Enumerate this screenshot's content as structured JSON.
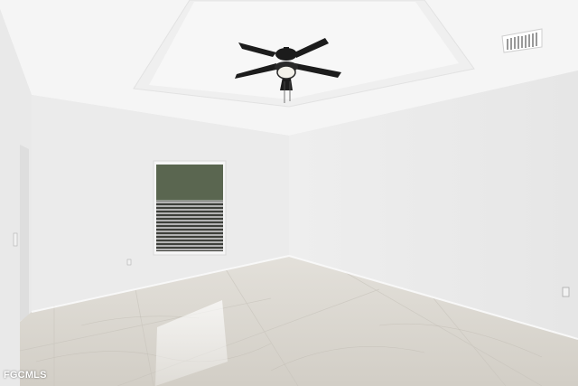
{
  "scene": {
    "description_free": true,
    "watermark_text": "FGCMLS",
    "colors": {
      "ceiling": "#f4f4f4",
      "wall_left": "#ececec",
      "wall_right": "#efefef",
      "wall_far": "#e6e6e6",
      "floor": "#d9d6d0",
      "fan": "#1c1c1c"
    }
  }
}
